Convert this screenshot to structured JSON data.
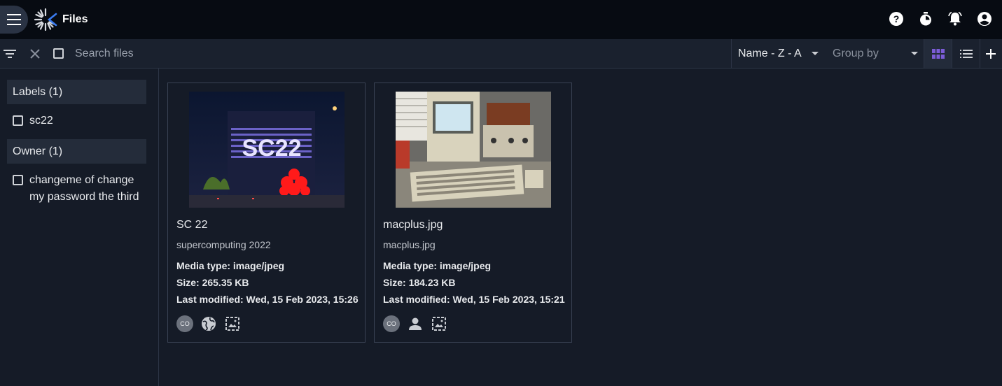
{
  "header": {
    "title": "Files"
  },
  "toolbar": {
    "search_placeholder": "Search files",
    "sort_value": "Name - Z - A",
    "group_placeholder": "Group by"
  },
  "sidebar": {
    "facets": [
      {
        "heading": "Labels (1)",
        "items": [
          {
            "label": "sc22"
          }
        ]
      },
      {
        "heading": "Owner (1)",
        "items": [
          {
            "label": "changeme of change my password the third"
          }
        ]
      }
    ]
  },
  "files": [
    {
      "title": "SC 22",
      "description": "supercomputing 2022",
      "media_type": "Media type: image/jpeg",
      "size": "Size: 265.35 KB",
      "modified": "Last modified: Wed, 15 Feb 2023, 15:26",
      "owner_initials": "CO",
      "visibility_icon": "globe-icon",
      "type_icon": "image-icon"
    },
    {
      "title": "macplus.jpg",
      "description": "macplus.jpg",
      "media_type": "Media type: image/jpeg",
      "size": "Size: 184.23 KB",
      "modified": "Last modified: Wed, 15 Feb 2023, 15:21",
      "owner_initials": "CO",
      "visibility_icon": "person-icon",
      "type_icon": "image-icon"
    }
  ],
  "colors": {
    "accent": "#7b5cd6",
    "background": "#151b27",
    "topbar": "#070b12"
  }
}
